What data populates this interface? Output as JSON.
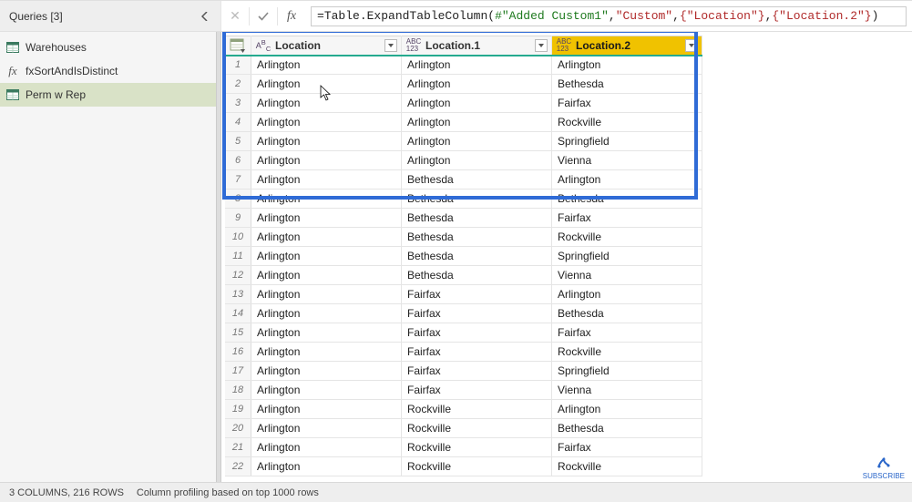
{
  "sidebar": {
    "title": "Queries [3]",
    "items": [
      {
        "label": "Warehouses",
        "icon": "table"
      },
      {
        "label": "fxSortAndIsDistinct",
        "icon": "fx"
      },
      {
        "label": "Perm w Rep",
        "icon": "table",
        "selected": true
      }
    ]
  },
  "formula": {
    "prefix": "= ",
    "fn": "Table.ExpandTableColumn",
    "step_ref": "#\"Added Custom1\"",
    "arg_col": "\"Custom\"",
    "arg_list1": "{\"Location\"}",
    "arg_list2": "{\"Location.2\"}"
  },
  "columns": [
    {
      "name": "Location",
      "datatype": "abc"
    },
    {
      "name": "Location.1",
      "datatype": "any"
    },
    {
      "name": "Location.2",
      "datatype": "any",
      "selected": true
    }
  ],
  "rows": [
    {
      "n": 1,
      "c": [
        "Arlington",
        "Arlington",
        "Arlington"
      ]
    },
    {
      "n": 2,
      "c": [
        "Arlington",
        "Arlington",
        "Bethesda"
      ]
    },
    {
      "n": 3,
      "c": [
        "Arlington",
        "Arlington",
        "Fairfax"
      ]
    },
    {
      "n": 4,
      "c": [
        "Arlington",
        "Arlington",
        "Rockville"
      ]
    },
    {
      "n": 5,
      "c": [
        "Arlington",
        "Arlington",
        "Springfield"
      ]
    },
    {
      "n": 6,
      "c": [
        "Arlington",
        "Arlington",
        "Vienna"
      ]
    },
    {
      "n": 7,
      "c": [
        "Arlington",
        "Bethesda",
        "Arlington"
      ]
    },
    {
      "n": 8,
      "c": [
        "Arlington",
        "Bethesda",
        "Bethesda"
      ]
    },
    {
      "n": 9,
      "c": [
        "Arlington",
        "Bethesda",
        "Fairfax"
      ]
    },
    {
      "n": 10,
      "c": [
        "Arlington",
        "Bethesda",
        "Rockville"
      ]
    },
    {
      "n": 11,
      "c": [
        "Arlington",
        "Bethesda",
        "Springfield"
      ]
    },
    {
      "n": 12,
      "c": [
        "Arlington",
        "Bethesda",
        "Vienna"
      ]
    },
    {
      "n": 13,
      "c": [
        "Arlington",
        "Fairfax",
        "Arlington"
      ]
    },
    {
      "n": 14,
      "c": [
        "Arlington",
        "Fairfax",
        "Bethesda"
      ]
    },
    {
      "n": 15,
      "c": [
        "Arlington",
        "Fairfax",
        "Fairfax"
      ]
    },
    {
      "n": 16,
      "c": [
        "Arlington",
        "Fairfax",
        "Rockville"
      ]
    },
    {
      "n": 17,
      "c": [
        "Arlington",
        "Fairfax",
        "Springfield"
      ]
    },
    {
      "n": 18,
      "c": [
        "Arlington",
        "Fairfax",
        "Vienna"
      ]
    },
    {
      "n": 19,
      "c": [
        "Arlington",
        "Rockville",
        "Arlington"
      ]
    },
    {
      "n": 20,
      "c": [
        "Arlington",
        "Rockville",
        "Bethesda"
      ]
    },
    {
      "n": 21,
      "c": [
        "Arlington",
        "Rockville",
        "Fairfax"
      ]
    },
    {
      "n": 22,
      "c": [
        "Arlington",
        "Rockville",
        "Rockville"
      ]
    }
  ],
  "status": {
    "cols_rows": "3 COLUMNS, 216 ROWS",
    "profiling": "Column profiling based on top 1000 rows"
  },
  "subscribe_label": "SUBSCRIBE"
}
